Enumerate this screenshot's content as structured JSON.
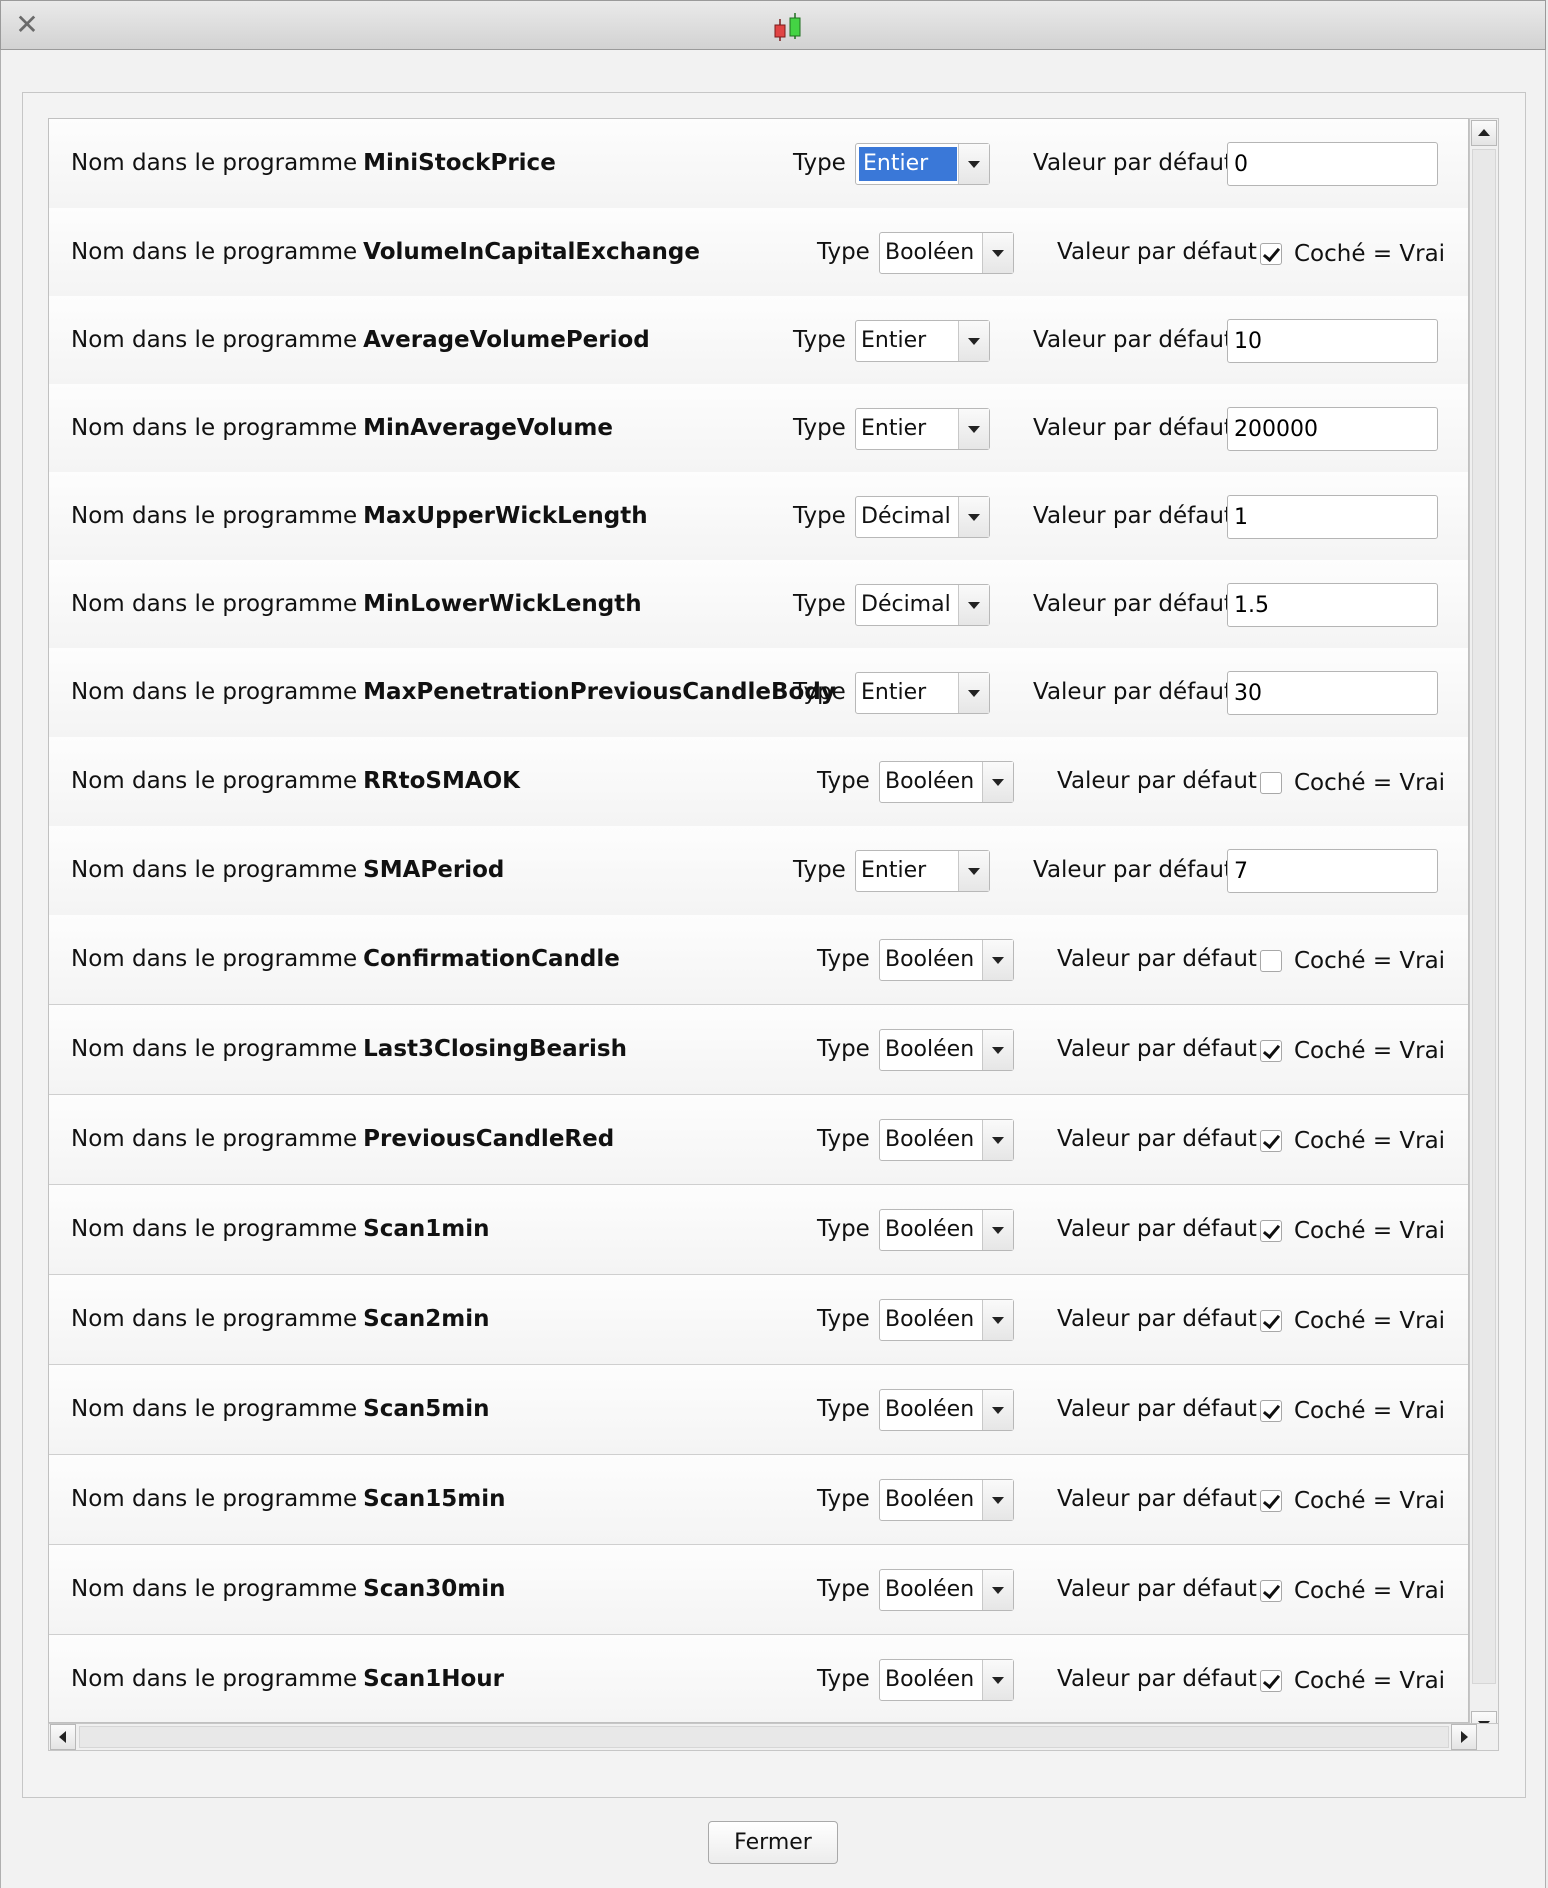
{
  "window": {
    "close_icon": "close-icon",
    "app_icon": "candlestick-icon",
    "close_button_label": "Fermer"
  },
  "labels": {
    "name_prefix": "Nom dans le programme",
    "type": "Type",
    "default": "Valeur par défaut",
    "checkbox_text": "Coché = Vrai"
  },
  "parameters": [
    {
      "name": "MiniStockPrice",
      "type": "Entier",
      "value": "0",
      "selected": true
    },
    {
      "name": "VolumeInCapitalExchange",
      "type": "Booléen",
      "checked": true
    },
    {
      "name": "AverageVolumePeriod",
      "type": "Entier",
      "value": "10"
    },
    {
      "name": "MinAverageVolume",
      "type": "Entier",
      "value": "200000"
    },
    {
      "name": "MaxUpperWickLength",
      "type": "Décimal",
      "value": "1"
    },
    {
      "name": "MinLowerWickLength",
      "type": "Décimal",
      "value": "1.5"
    },
    {
      "name": "MaxPenetrationPreviousCandleBody",
      "type": "Entier",
      "value": "30"
    },
    {
      "name": "RRtoSMAOK",
      "type": "Booléen",
      "checked": false
    },
    {
      "name": "SMAPeriod",
      "type": "Entier",
      "value": "7"
    },
    {
      "name": "ConfirmationCandle",
      "type": "Booléen",
      "checked": false
    },
    {
      "name": "Last3ClosingBearish",
      "type": "Booléen",
      "checked": true
    },
    {
      "name": "PreviousCandleRed",
      "type": "Booléen",
      "checked": true
    },
    {
      "name": "Scan1min",
      "type": "Booléen",
      "checked": true
    },
    {
      "name": "Scan2min",
      "type": "Booléen",
      "checked": true
    },
    {
      "name": "Scan5min",
      "type": "Booléen",
      "checked": true
    },
    {
      "name": "Scan15min",
      "type": "Booléen",
      "checked": true
    },
    {
      "name": "Scan30min",
      "type": "Booléen",
      "checked": true
    },
    {
      "name": "Scan1Hour",
      "type": "Booléen",
      "checked": true
    }
  ]
}
